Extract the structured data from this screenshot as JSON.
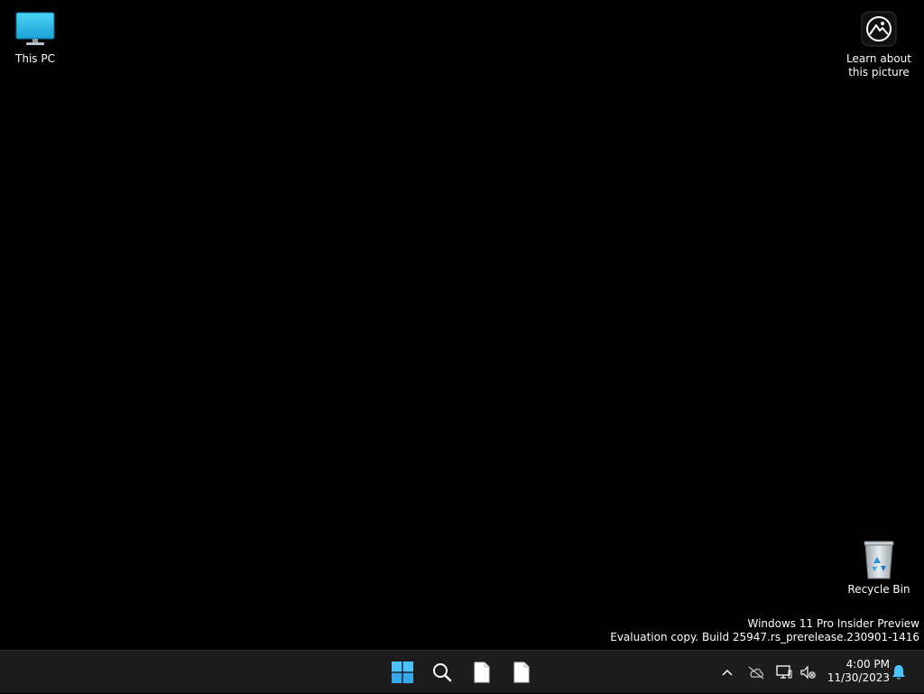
{
  "desktop": {
    "icons": {
      "this_pc": {
        "label": "This PC",
        "icon": "monitor-icon"
      },
      "learn": {
        "label_line1": "Learn about",
        "label_line2": "this picture",
        "icon": "camera-icon"
      },
      "recycle_bin": {
        "label": "Recycle Bin",
        "icon": "recycle-bin-icon"
      }
    },
    "watermark": {
      "line1": "Windows 11 Pro Insider Preview",
      "line2": "Evaluation copy. Build 25947.rs_prerelease.230901-1416"
    },
    "background_color": "#000000"
  },
  "taskbar": {
    "background_color": "#1c1c1c",
    "apps": [
      {
        "name": "start",
        "icon": "windows-logo-icon"
      },
      {
        "name": "search",
        "icon": "search-icon"
      },
      {
        "name": "document-1",
        "icon": "document-icon"
      },
      {
        "name": "document-2",
        "icon": "document-icon"
      }
    ],
    "tray": {
      "icons": [
        "chevron-up-icon",
        "cloud-offline-icon",
        "network-icon",
        "volume-muted-icon",
        "bell-icon"
      ],
      "time": "4:00 PM",
      "date": "11/30/2023"
    },
    "accent_color": "#4cc2ff"
  }
}
